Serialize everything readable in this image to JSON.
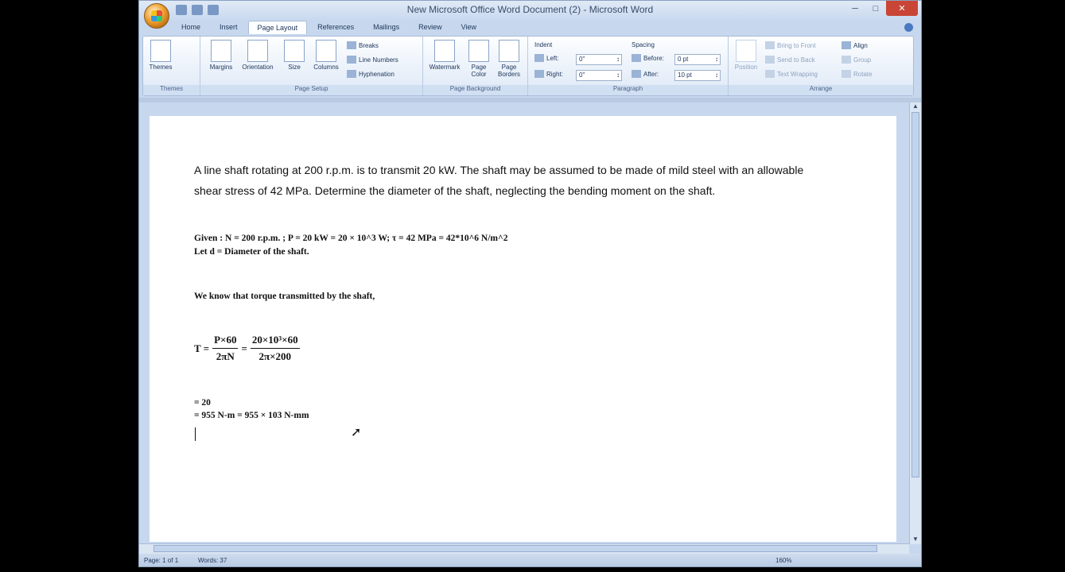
{
  "window": {
    "title": "New Microsoft Office Word Document (2) - Microsoft Word"
  },
  "ribbon": {
    "tabs": [
      "Home",
      "Insert",
      "Page Layout",
      "References",
      "Mailings",
      "Review",
      "View"
    ],
    "themes": {
      "label": "Themes",
      "group": "Themes"
    },
    "page_setup": {
      "margins": "Margins",
      "orientation": "Orientation",
      "size": "Size",
      "columns": "Columns",
      "breaks": "Breaks",
      "line_numbers": "Line Numbers",
      "hyphenation": "Hyphenation",
      "group": "Page Setup"
    },
    "page_background": {
      "watermark": "Watermark",
      "page_color": "Page Color",
      "page_borders": "Page Borders",
      "group": "Page Background"
    },
    "paragraph": {
      "indent": "Indent",
      "left_label": "Left:",
      "left_value": "0\"",
      "right_label": "Right:",
      "right_value": "0\"",
      "spacing": "Spacing",
      "before_label": "Before:",
      "before_value": "0 pt",
      "after_label": "After:",
      "after_value": "10 pt",
      "group": "Paragraph"
    },
    "arrange": {
      "position": "Position",
      "bring_to_front": "Bring to Front",
      "send_to_back": "Send to Back",
      "text_wrapping": "Text Wrapping",
      "align": "Align",
      "group_btn": "Group",
      "rotate": "Rotate",
      "group": "Arrange"
    }
  },
  "document": {
    "paragraph": "A line shaft rotating at 200 r.p.m. is to transmit 20 kW. The shaft may be assumed to be made of mild steel with an allowable shear stress of 42 MPa. Determine the diameter of the shaft, neglecting the bending moment on the shaft.",
    "given": "Given : N = 200 r.p.m. ; P = 20 kW = 20 × 10^3 W; τ = 42 MPa = 42*10^6 N/m^2",
    "let_d": "Let d = Diameter of the shaft.",
    "we_know": "We know that torque transmitted by the shaft,",
    "eq_T": "T =",
    "eq_num1": "P×60",
    "eq_den1": "2πN",
    "eq_eq": "=",
    "eq_num2": "20×10³×60",
    "eq_den2": "2π×200",
    "line1": "= 20",
    "line2": "= 955 N-m = 955 × 103 N-mm"
  },
  "status": {
    "page": "Page: 1 of 1",
    "words": "Words: 37",
    "zoom": "160%"
  }
}
